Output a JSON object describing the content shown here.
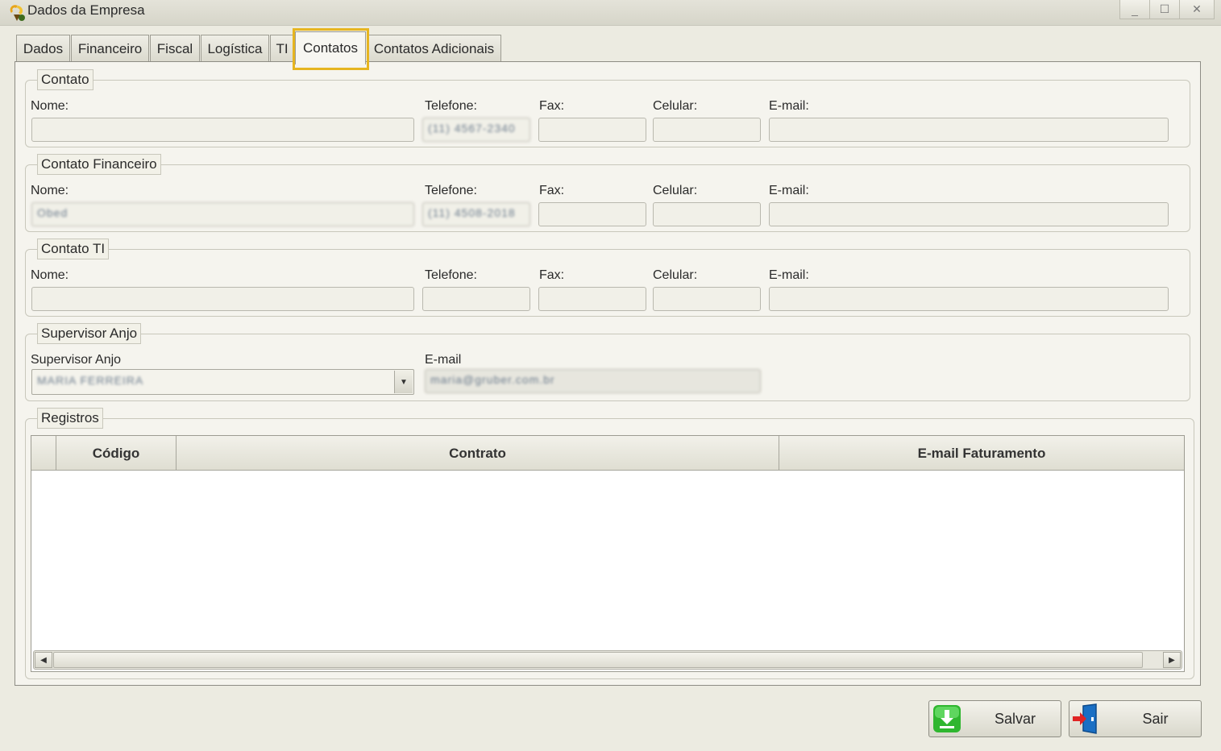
{
  "window": {
    "title": "Dados da Empresa",
    "minimize_glyph": "_",
    "maximize_glyph": "☐",
    "close_glyph": "✕"
  },
  "tabs": [
    {
      "label": "Dados",
      "active": false
    },
    {
      "label": "Financeiro",
      "active": false
    },
    {
      "label": "Fiscal",
      "active": false
    },
    {
      "label": "Logística",
      "active": false
    },
    {
      "label": "TI",
      "active": false
    },
    {
      "label": "Contatos",
      "active": true
    },
    {
      "label": "Contatos Adicionais",
      "active": false
    }
  ],
  "contato": {
    "legend": "Contato",
    "nome_label": "Nome:",
    "nome_value": "",
    "telefone_label": "Telefone:",
    "telefone_value": "(11) 4567-2340",
    "fax_label": "Fax:",
    "fax_value": "",
    "celular_label": "Celular:",
    "celular_value": "",
    "email_label": "E-mail:",
    "email_value": ""
  },
  "contato_financeiro": {
    "legend": "Contato Financeiro",
    "nome_label": "Nome:",
    "nome_value": "Obed",
    "telefone_label": "Telefone:",
    "telefone_value": "(11) 4508-2018",
    "fax_label": "Fax:",
    "fax_value": "",
    "celular_label": "Celular:",
    "celular_value": "",
    "email_label": "E-mail:",
    "email_value": ""
  },
  "contato_ti": {
    "legend": "Contato TI",
    "nome_label": "Nome:",
    "nome_value": "",
    "telefone_label": "Telefone:",
    "telefone_value": "",
    "fax_label": "Fax:",
    "fax_value": "",
    "celular_label": "Celular:",
    "celular_value": "",
    "email_label": "E-mail:",
    "email_value": ""
  },
  "supervisor": {
    "legend": "Supervisor Anjo",
    "supervisor_label": "Supervisor Anjo",
    "supervisor_value": "MARIA FERREIRA",
    "email_label": "E-mail",
    "email_value": "maria@gruber.com.br"
  },
  "registros": {
    "legend": "Registros",
    "columns": [
      "Código",
      "Contrato",
      "E-mail Faturamento"
    ],
    "rows": []
  },
  "actions": {
    "save_label": "Salvar",
    "exit_label": "Sair"
  },
  "colors": {
    "tab_highlight": "#e6b520",
    "window_bg": "#ecebe1",
    "save_icon": "#2fb62f",
    "exit_icon": "#1a6fc4"
  }
}
